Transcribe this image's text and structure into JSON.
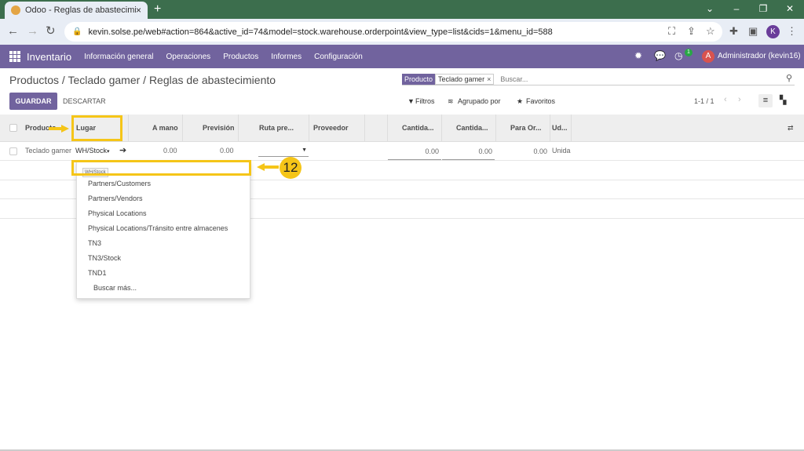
{
  "browser": {
    "tab_title": "Odoo - Reglas de abastecimiento",
    "tab_close": "×",
    "new_tab": "+",
    "url": "kevin.solse.pe/web#action=864&active_id=74&model=stock.warehouse.orderpoint&view_type=list&cids=1&menu_id=588",
    "profile_initial": "K"
  },
  "navbar": {
    "app": "Inventario",
    "menu": [
      "Información general",
      "Operaciones",
      "Productos",
      "Informes",
      "Configuración"
    ],
    "activity_count": "1",
    "user_initial": "A",
    "user": "Administrador (kevin16)"
  },
  "breadcrumb": "Productos / Teclado gamer / Reglas de abastecimiento",
  "search": {
    "facet_label": "Producto",
    "facet_value": "Teclado gamer",
    "facet_remove": "×",
    "placeholder": "Buscar..."
  },
  "buttons": {
    "save": "GUARDAR",
    "discard": "DESCARTAR",
    "filters": "Filtros",
    "group_by": "Agrupado por",
    "favorites": "Favoritos"
  },
  "pager": "1-1 / 1",
  "columns": [
    "Producto",
    "Lugar",
    "A mano",
    "Previsión",
    "Ruta pre...",
    "Proveedor",
    "Cantida...",
    "Cantida...",
    "Para Or...",
    "Ud..."
  ],
  "row": {
    "product": "Teclado gamer",
    "location": "WH/Stock",
    "on_hand": "0.00",
    "forecast": "0.00",
    "min_qty": "0.00",
    "max_qty": "0.00",
    "to_order": "0.00",
    "uom": "Unida"
  },
  "dropdown": {
    "tooltip": "WH/Stock",
    "items": [
      "Partners/Customers",
      "Partners/Vendors",
      "Physical Locations",
      "Physical Locations/Tránsito entre almacenes",
      "TN3",
      "TN3/Stock",
      "TND1"
    ],
    "search_more": "Buscar más..."
  },
  "annotation": {
    "step": "12",
    "color": "#f5c518"
  },
  "colors": {
    "brand": "#71639e",
    "tab_bar": "#3c6e4d"
  }
}
